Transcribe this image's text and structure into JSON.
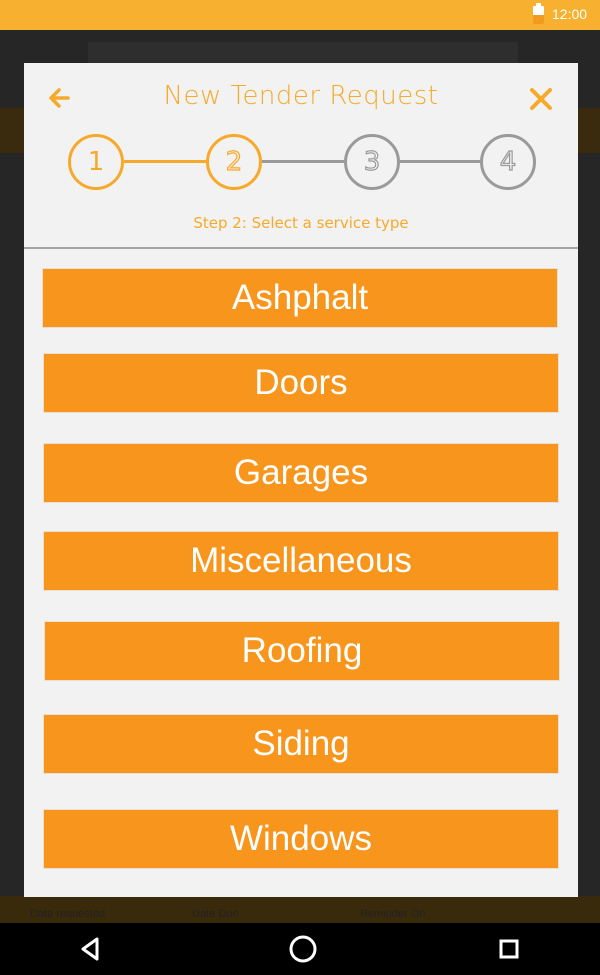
{
  "status_bar": {
    "time": "12:00"
  },
  "background": {
    "col1": "Date requested",
    "col2": "Date Due",
    "col3": "Reminder On"
  },
  "dialog": {
    "title": "New Tender Request",
    "back_icon": "arrow-left-icon",
    "close_icon": "close-icon",
    "steps": [
      "1",
      "2",
      "3",
      "4"
    ],
    "current_step": 2,
    "step_caption": "Step 2: Select a service type",
    "services": [
      "Ashphalt",
      "Doors",
      "Garages",
      "Miscellaneous",
      "Roofing",
      "Siding",
      "Windows"
    ]
  },
  "nav_bar": {
    "back_icon": "nav-back-icon",
    "home_icon": "nav-home-icon",
    "recents_icon": "nav-recents-icon"
  },
  "colors": {
    "accent": "#f7a92a",
    "button": "#f7951d",
    "inactive": "#9a9a9a",
    "status_bar": "#f7b02f"
  }
}
